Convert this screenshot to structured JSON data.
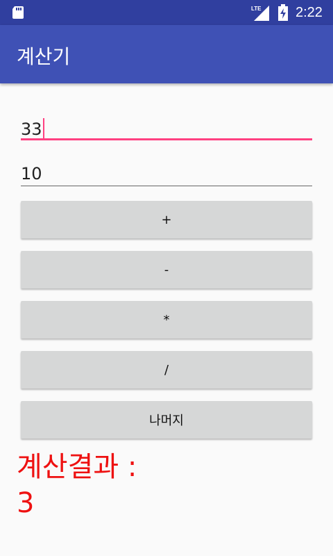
{
  "statusbar": {
    "time": "2:22",
    "network": "LTE"
  },
  "appbar": {
    "title": "계산기"
  },
  "inputs": {
    "first_value": "33",
    "second_value": "10"
  },
  "buttons": [
    {
      "label": "+"
    },
    {
      "label": "-"
    },
    {
      "label": "*"
    },
    {
      "label": "/"
    },
    {
      "label": "나머지"
    }
  ],
  "result": {
    "label": "계산결과 :",
    "value": "3"
  },
  "colors": {
    "status_bar": "#303f9f",
    "app_bar": "#3f51b5",
    "accent": "#ff4081",
    "result_text": "#ee1111",
    "button_bg": "#d6d7d7"
  }
}
